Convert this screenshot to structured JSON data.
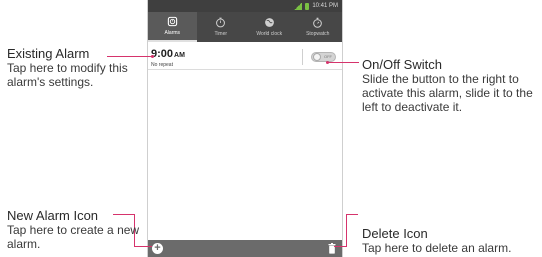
{
  "statusbar": {
    "time": "10:41 PM"
  },
  "tabs": [
    {
      "label": "Alarms",
      "icon": "alarm-clock-icon",
      "active": true
    },
    {
      "label": "Timer",
      "icon": "timer-icon",
      "active": false
    },
    {
      "label": "World clock",
      "icon": "world-clock-icon",
      "active": false
    },
    {
      "label": "Stopwatch",
      "icon": "stopwatch-icon",
      "active": false
    }
  ],
  "alarm": {
    "time": "9:00",
    "ampm": "AM",
    "repeat": "No repeat",
    "switch_label": "OFF"
  },
  "callouts": {
    "existing": {
      "title": "Existing Alarm",
      "body": "Tap here to modify this alarm's settings."
    },
    "onoff": {
      "title": "On/Off Switch",
      "body": "Slide the button to the right to activate this alarm, slide it to the left to deactivate it."
    },
    "new_alarm": {
      "title": "New Alarm Icon",
      "body": "Tap here to create a new alarm."
    },
    "delete": {
      "title": "Delete Icon",
      "body": "Tap here to delete an alarm."
    }
  },
  "colors": {
    "leader": "#d6336c",
    "tabbar": "#474747",
    "bottombar": "#6b6b6b"
  }
}
